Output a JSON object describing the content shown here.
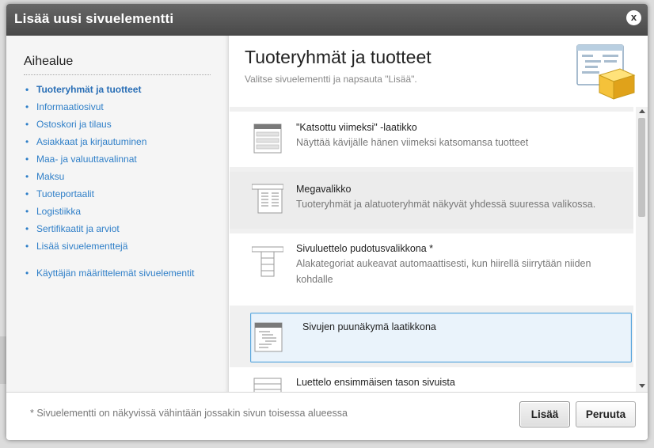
{
  "dialog": {
    "title": "Lisää uusi sivuelementti",
    "close_label": "x"
  },
  "sidebar": {
    "heading": "Aihealue",
    "categories": [
      {
        "label": "Tuoteryhmät ja tuotteet",
        "active": true
      },
      {
        "label": "Informaatiosivut"
      },
      {
        "label": "Ostoskori ja tilaus"
      },
      {
        "label": "Asiakkaat ja kirjautuminen"
      },
      {
        "label": "Maa- ja valuuttavalinnat"
      },
      {
        "label": "Maksu"
      },
      {
        "label": "Tuoteportaalit"
      },
      {
        "label": "Logistiikka"
      },
      {
        "label": "Sertifikaatit ja arviot"
      },
      {
        "label": "Lisää sivuelementtejä"
      },
      {
        "label": "Käyttäjän määrittelemät sivuelementit"
      }
    ]
  },
  "main": {
    "title": "Tuoteryhmät ja tuotteet",
    "subtitle": "Valitse sivuelementti ja napsauta \"Lisää\".",
    "elements": [
      {
        "name": "\"Katsottu viimeksi\" -laatikko",
        "description": "Näyttää kävijälle hänen viimeksi katsomansa tuotteet",
        "icon": "recently-viewed-box-icon"
      },
      {
        "name": "Megavalikko",
        "description": "Tuoteryhmät ja alatuoteryhmät näkyvät yhdessä suuressa valikossa.",
        "icon": "mega-menu-icon"
      },
      {
        "name": "Sivuluettelo pudotusvalikkona *",
        "description": "Alakategoriat aukeavat automaattisesti, kun hiirellä siirrytään niiden kohdalle",
        "icon": "dropdown-page-list-icon"
      },
      {
        "name": "Sivujen puunäkymä laatikkona",
        "description": "",
        "icon": "page-tree-box-icon",
        "selected": true
      },
      {
        "name": "Luettelo ensimmäisen tason sivuista",
        "description": "",
        "icon": "first-level-page-list-icon"
      }
    ]
  },
  "footer": {
    "note": "* Sivuelementti on näkyvissä vähintään jossakin sivun toisessa alueessa",
    "add_label": "Lisää",
    "cancel_label": "Peruuta"
  },
  "colors": {
    "link": "#2f7fc8",
    "titlebar": "#555555",
    "selected_border": "#5aa6dd"
  }
}
